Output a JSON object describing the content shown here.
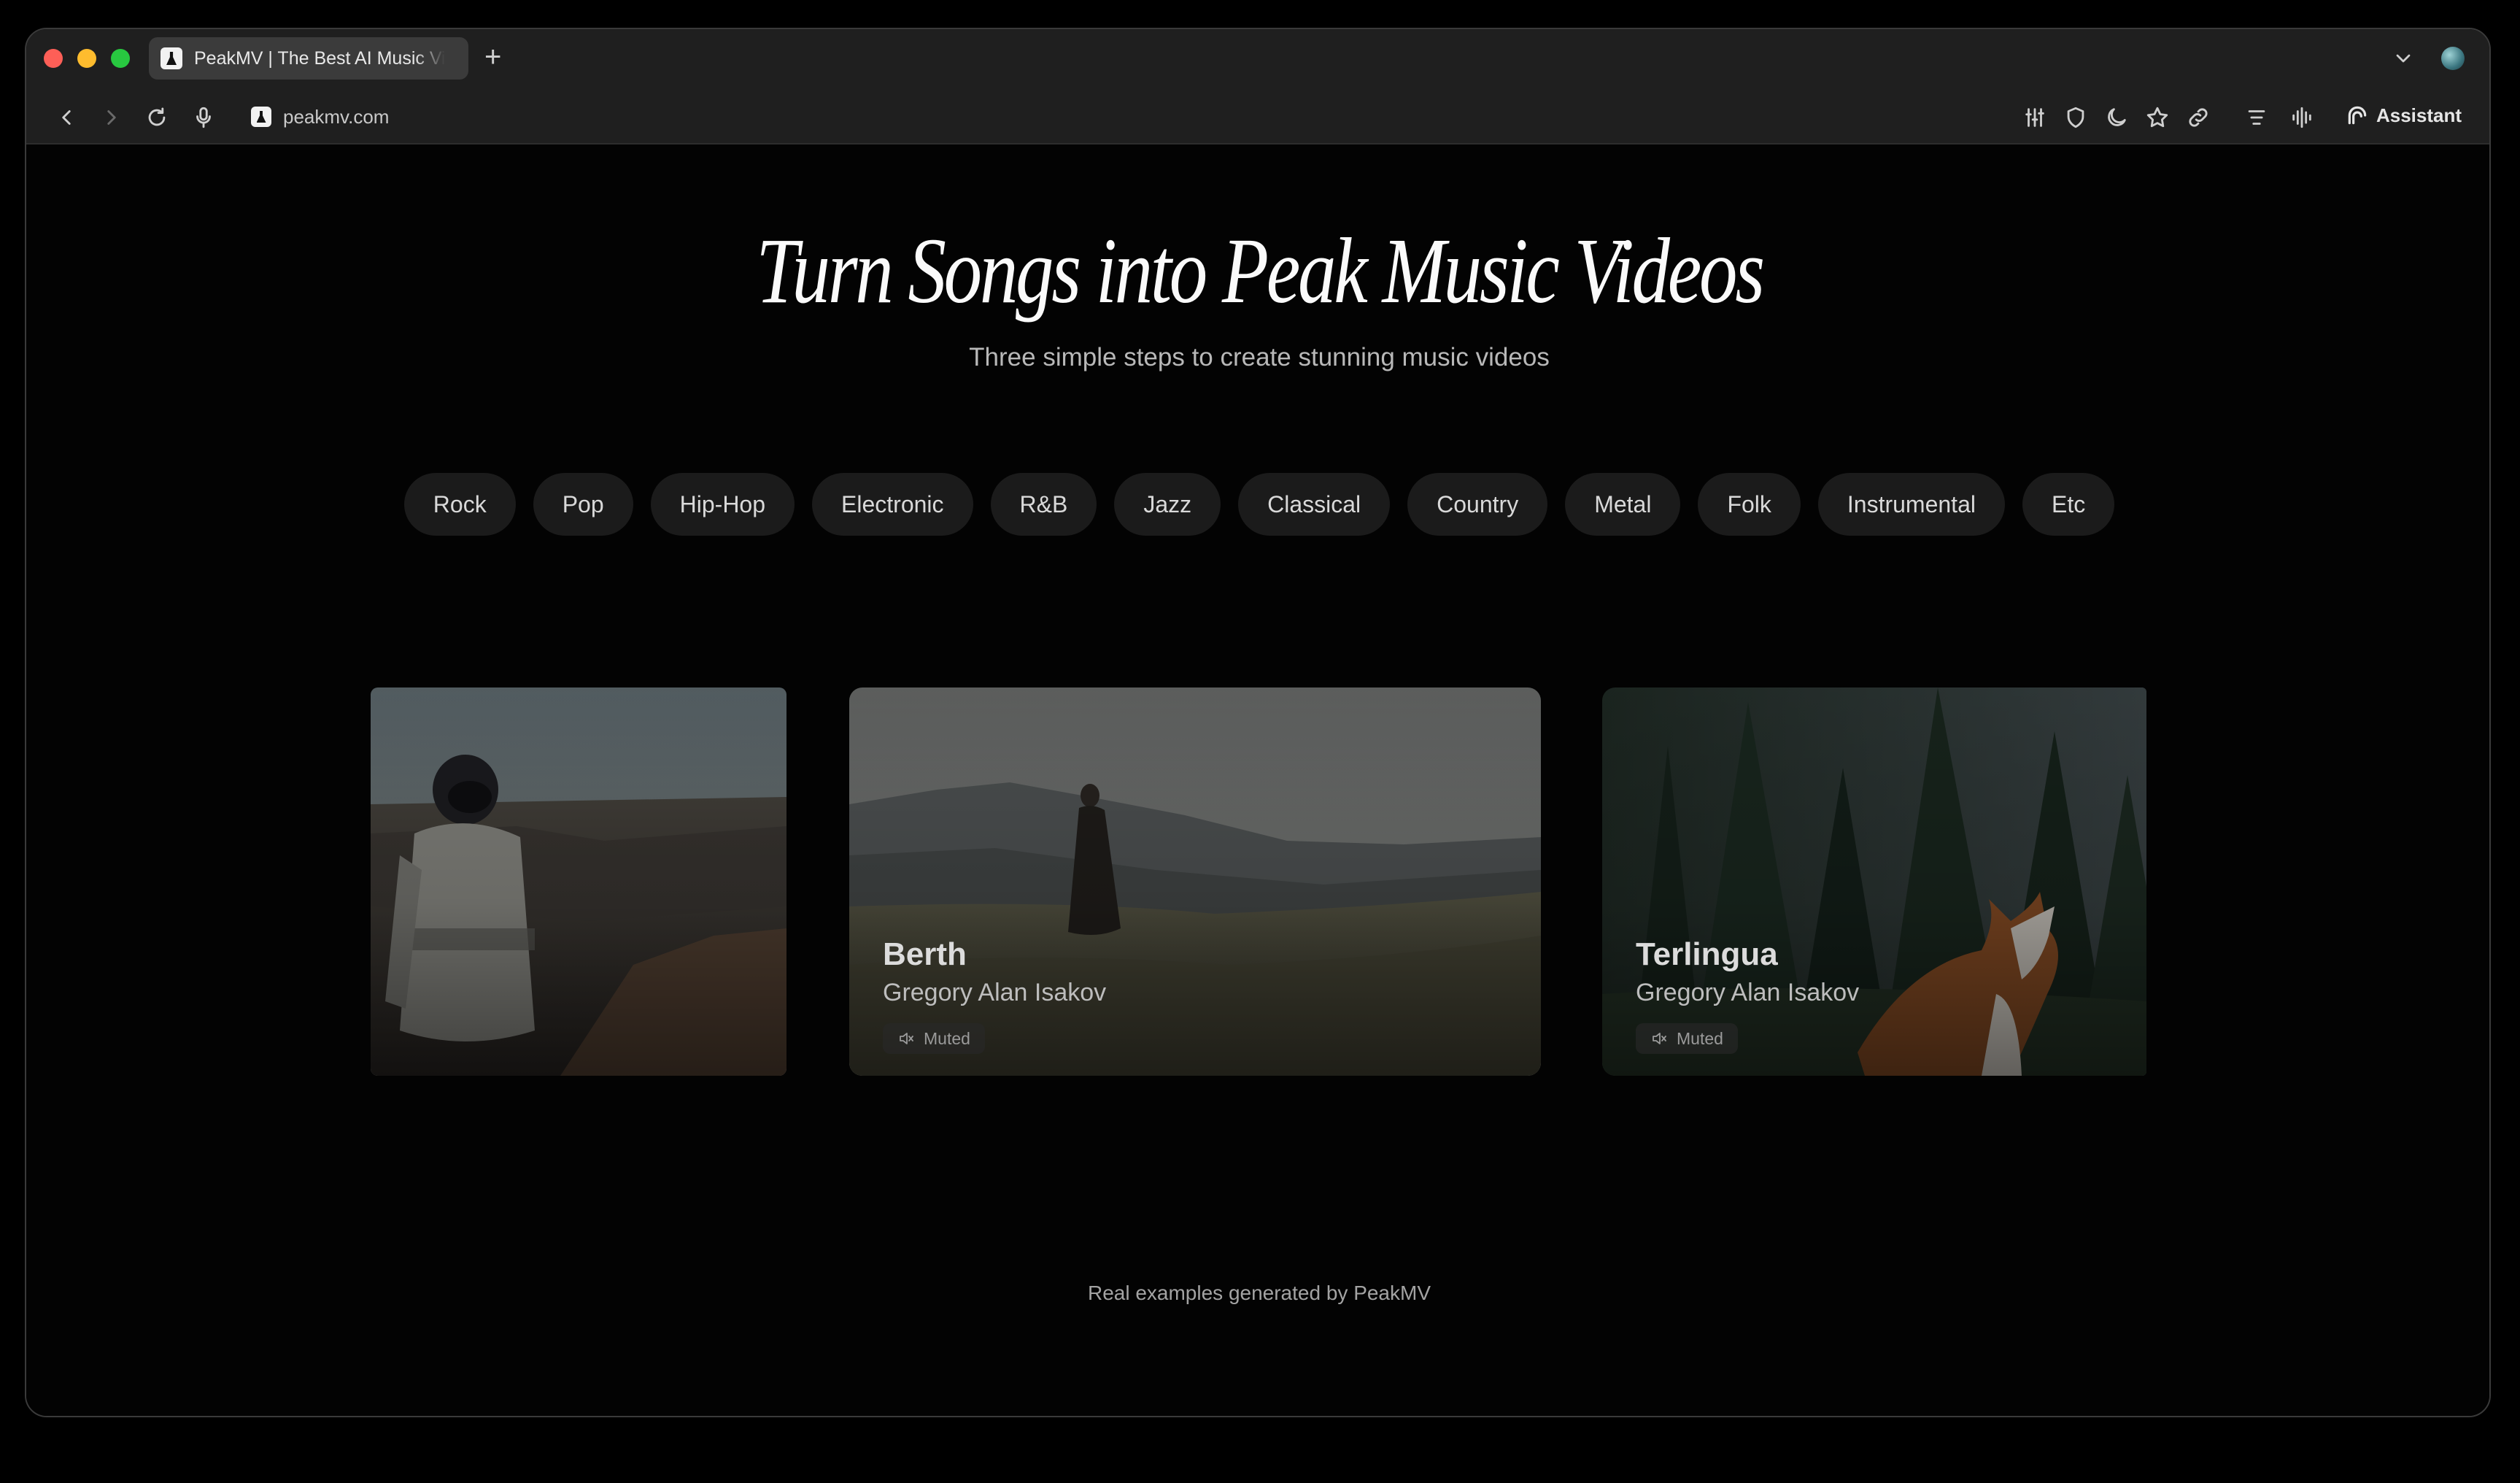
{
  "browser": {
    "tab_title": "PeakMV | The Best AI Music Video Generator",
    "new_tab_label": "+",
    "url": "peakmv.com",
    "assistant_label": "Assistant"
  },
  "hero": {
    "title": "Turn Songs into Peak Music Videos",
    "subtitle": "Three simple steps to create stunning music videos"
  },
  "genres": [
    "Rock",
    "Pop",
    "Hip-Hop",
    "Electronic",
    "R&B",
    "Jazz",
    "Classical",
    "Country",
    "Metal",
    "Folk",
    "Instrumental",
    "Etc"
  ],
  "cards": [
    {
      "title": "Berth",
      "artist": "Gregory Alan Isakov",
      "status": "Muted"
    },
    {
      "title": "Terlingua",
      "artist": "Gregory Alan Isakov",
      "status": "Muted"
    }
  ],
  "footer": {
    "note": "Real examples generated by PeakMV"
  },
  "colors": {
    "background": "#030303",
    "browser_chrome": "#1f1f1f",
    "pill_background": "#1b1b1b",
    "title_text": "#fafafa"
  }
}
